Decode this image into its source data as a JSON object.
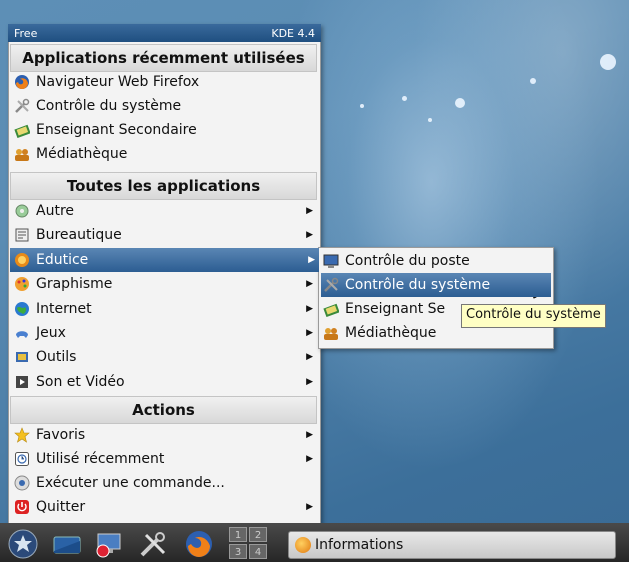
{
  "menu": {
    "header_left": "Free",
    "header_right": "KDE 4.4",
    "section_recent": "Applications récemment utilisées",
    "recent": [
      {
        "label": "Navigateur Web Firefox",
        "ul": "N",
        "icon": "firefox-icon"
      },
      {
        "label": "Contrôle du système",
        "ul": "C",
        "icon": "tools-icon"
      },
      {
        "label": "Enseignant Secondaire",
        "ul": "E",
        "icon": "teacher-icon"
      },
      {
        "label": "Médiathèque",
        "ul": "M",
        "icon": "library-icon"
      }
    ],
    "section_all": "Toutes les applications",
    "apps": [
      {
        "label": "Autre",
        "icon": "other-icon"
      },
      {
        "label": "Bureautique",
        "icon": "office-icon"
      },
      {
        "label": "Edutice",
        "icon": "edutice-icon"
      },
      {
        "label": "Graphisme",
        "icon": "graphics-icon"
      },
      {
        "label": "Internet",
        "icon": "internet-icon"
      },
      {
        "label": "Jeux",
        "icon": "games-icon"
      },
      {
        "label": "Outils",
        "icon": "tools-folder-icon"
      },
      {
        "label": "Son et Vidéo",
        "icon": "multimedia-icon"
      }
    ],
    "section_actions": "Actions",
    "actions": [
      {
        "label": "Favoris",
        "icon": "star-icon",
        "arrow": true
      },
      {
        "label": "Utilisé récemment",
        "icon": "recent-icon",
        "arrow": true
      },
      {
        "label": "Exécuter une commande...",
        "icon": "run-icon",
        "arrow": false
      },
      {
        "label": "Quitter",
        "icon": "quit-icon",
        "arrow": true
      }
    ]
  },
  "submenu": {
    "items": [
      {
        "label": "Contrôle du poste",
        "icon": "monitor-icon"
      },
      {
        "label": "Contrôle du système",
        "icon": "tools-icon"
      },
      {
        "label": "Enseignant Se",
        "icon": "teacher-icon"
      },
      {
        "label": "Médiathèque",
        "icon": "library-icon"
      }
    ]
  },
  "tooltip": "Contrôle du système",
  "panel": {
    "task_label": "Informations",
    "pager": [
      "1",
      "2",
      "3",
      "4"
    ]
  },
  "colors": {
    "highlight": "#3a6a9e",
    "tooltip_bg": "#ffffc4",
    "panel_bg": "#2d2d2d"
  }
}
